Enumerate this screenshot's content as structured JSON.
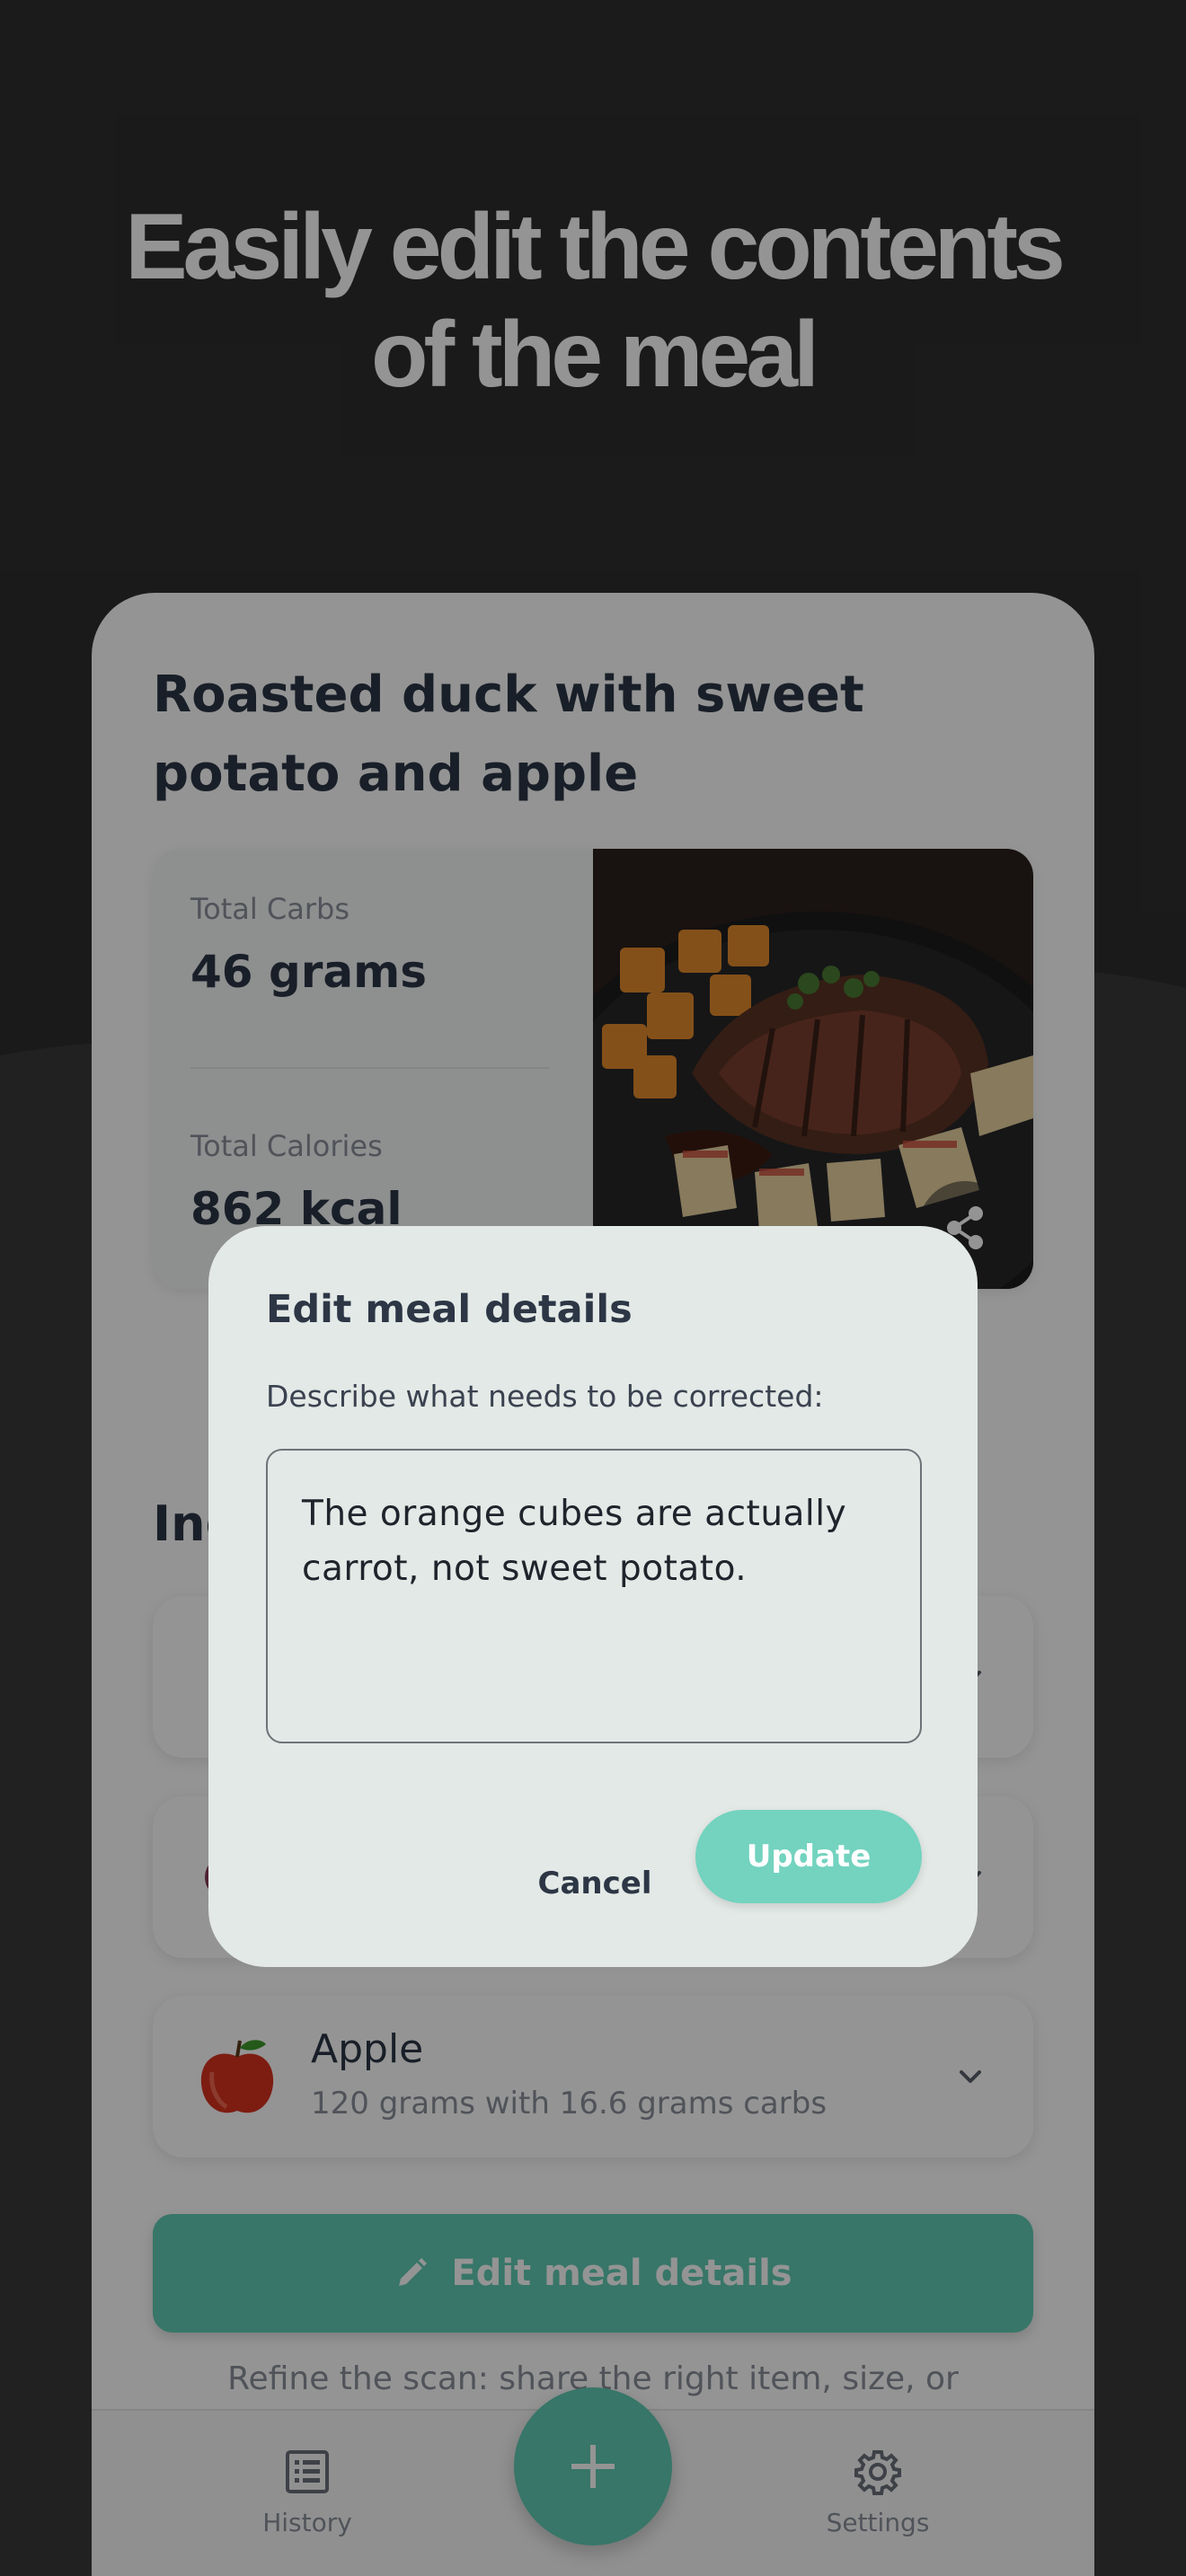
{
  "headline": {
    "line1": "Easily edit the contents",
    "line2": "of the meal"
  },
  "meal": {
    "title": "Roasted duck with sweet potato and apple",
    "carbs_label": "Total Carbs",
    "carbs_value": "46 grams",
    "calories_label": "Total Calories",
    "calories_value": "862 kcal"
  },
  "ingredients": {
    "heading": "Ingredients",
    "items": [
      {
        "name": "",
        "detail": "",
        "emoji": "sweet-potato-icon"
      },
      {
        "name": "",
        "detail": "",
        "emoji": "duck-icon"
      },
      {
        "name": "Apple",
        "detail": "120 grams with 16.6 grams carbs",
        "emoji": "apple-icon"
      }
    ]
  },
  "edit_button": {
    "label": "Edit meal details",
    "icon": "pencil-icon"
  },
  "refine_text": "Refine the scan: share the right item, size, or",
  "nav": {
    "history_label": "History",
    "settings_label": "Settings",
    "fab_icon": "plus-icon"
  },
  "dialog": {
    "title": "Edit meal details",
    "description": "Describe what needs to be corrected:",
    "input_value": "The orange cubes are actually carrot, not sweet potato.",
    "cancel_label": "Cancel",
    "update_label": "Update"
  },
  "colors": {
    "accent": "#5fcbb4",
    "update_button": "#73d3bf",
    "dialog_bg": "#e3e9e6",
    "background": "#2e2e2e",
    "text_dark": "#2c3645"
  }
}
